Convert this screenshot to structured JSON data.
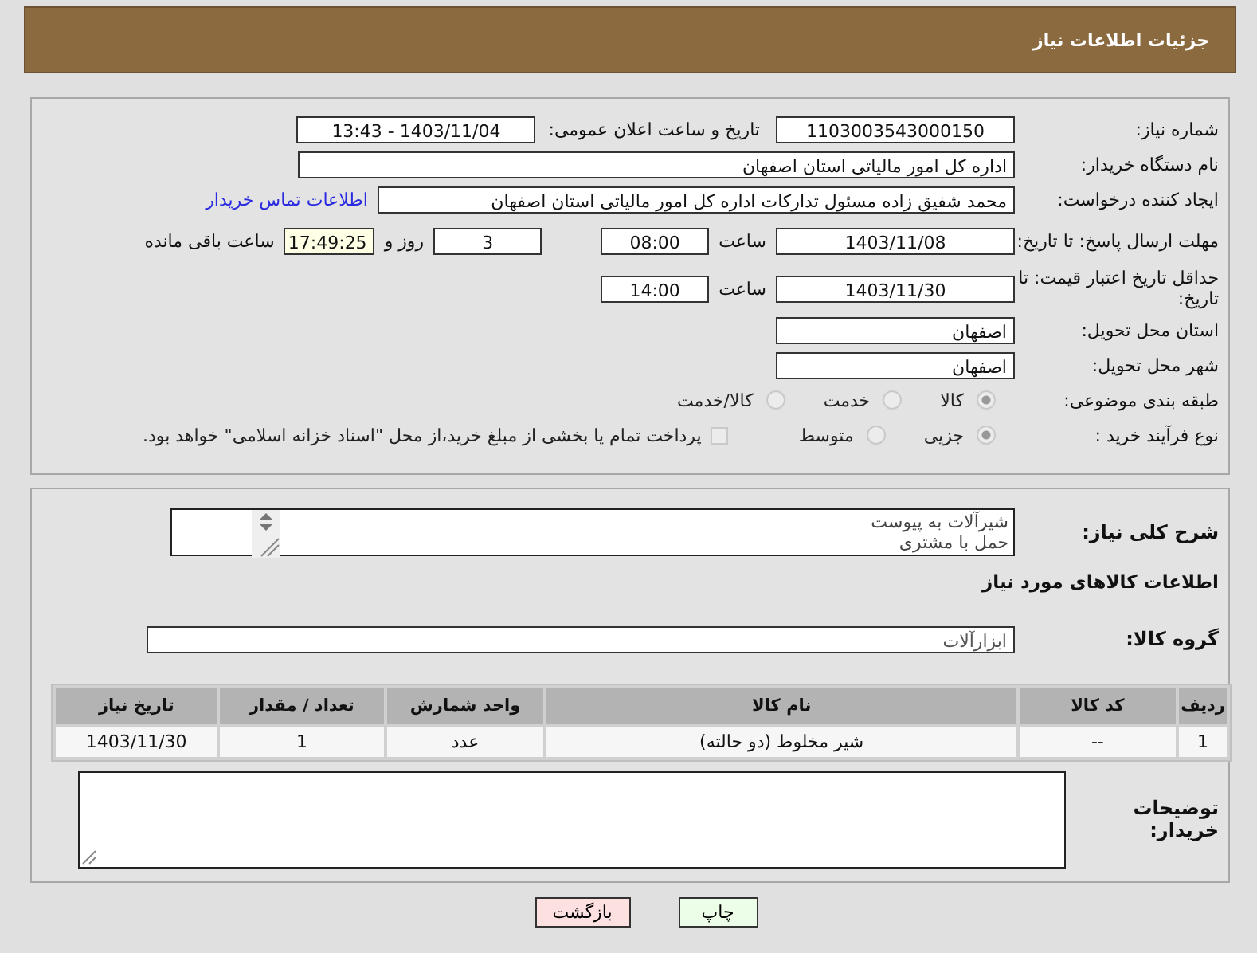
{
  "header": {
    "title": "جزئیات اطلاعات نیاز"
  },
  "need_number": {
    "label": "شماره نیاز:",
    "value": "1103003543000150"
  },
  "announce": {
    "label": "تاریخ و ساعت اعلان عمومی:",
    "value": "1403/11/04 - 13:43"
  },
  "buyer": {
    "label": "نام دستگاه خریدار:",
    "value": "اداره کل امور مالیاتی استان اصفهان"
  },
  "creator": {
    "label": "ایجاد کننده درخواست:",
    "value": "محمد شفیق زاده مسئول تدارکات اداره کل امور مالیاتی استان اصفهان",
    "link": "اطلاعات تماس خریدار"
  },
  "deadline": {
    "label": "مهلت ارسال پاسخ: تا تاریخ:",
    "date": "1403/11/08",
    "time_label": "ساعت",
    "time": "08:00",
    "days": "3",
    "days_label": "روز و",
    "remaining": "17:49:25",
    "remaining_label": "ساعت باقی مانده"
  },
  "validity": {
    "label": "حداقل تاریخ اعتبار قیمت: تا تاریخ:",
    "date": "1403/11/30",
    "time_label": "ساعت",
    "time": "14:00"
  },
  "province": {
    "label": "استان محل تحویل:",
    "value": "اصفهان"
  },
  "city": {
    "label": "شهر محل تحویل:",
    "value": "اصفهان"
  },
  "category": {
    "label": "طبقه بندی موضوعی:",
    "options": [
      {
        "label": "کالا",
        "selected": true
      },
      {
        "label": "خدمت",
        "selected": false
      },
      {
        "label": "کالا/خدمت",
        "selected": false
      }
    ]
  },
  "process": {
    "label": "نوع فرآیند خرید :",
    "options": [
      {
        "label": "جزیی",
        "selected": true
      },
      {
        "label": "متوسط",
        "selected": false
      }
    ],
    "payment": {
      "label": "پرداخت تمام یا بخشی از مبلغ خرید،از محل \"اسناد خزانه اسلامی\" خواهد بود.",
      "checked": false
    }
  },
  "description": {
    "label": "شرح کلی نیاز:",
    "lines": [
      "شیرآلات به پیوست",
      "حمل با مشتری"
    ]
  },
  "goods_heading": "اطلاعات کالاهای مورد نیاز",
  "goods_group": {
    "label": "گروه کالا:",
    "value": "ابزارآلات"
  },
  "table": {
    "columns": [
      "ردیف",
      "کد کالا",
      "نام کالا",
      "واحد شمارش",
      "تعداد / مقدار",
      "تاریخ نیاز"
    ],
    "rows": [
      [
        "1",
        "--",
        "شیر مخلوط (دو حالته)",
        "عدد",
        "1",
        "1403/11/30"
      ]
    ]
  },
  "buyer_notes": {
    "label": "توضیحات خریدار:"
  },
  "buttons": [
    {
      "label": "چاپ",
      "kind": "print"
    },
    {
      "label": "بازگشت",
      "kind": "back"
    }
  ]
}
